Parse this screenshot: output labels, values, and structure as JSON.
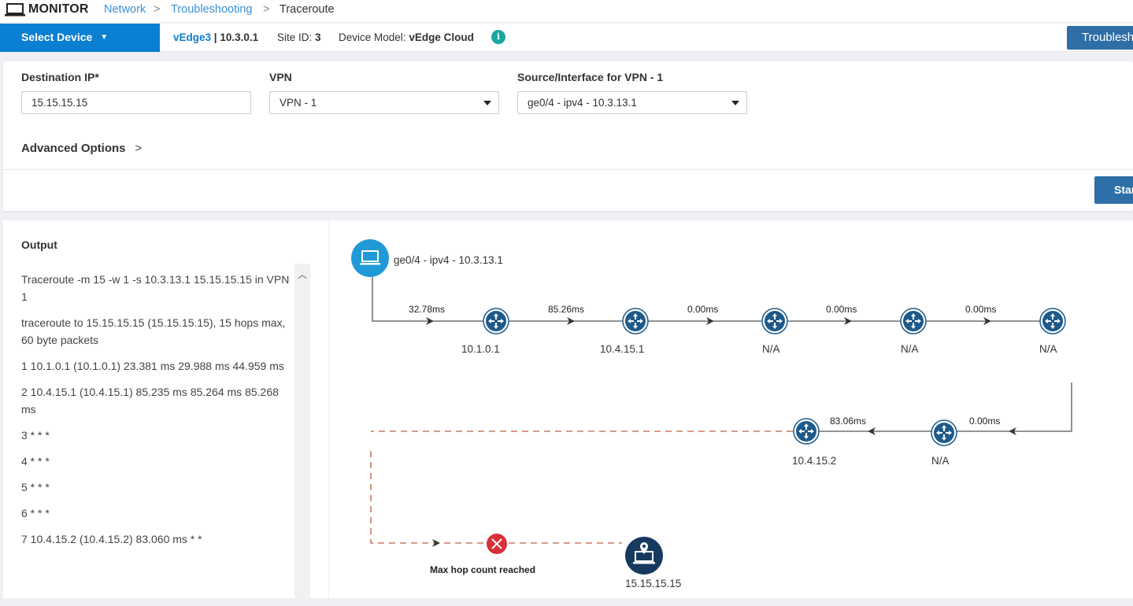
{
  "header": {
    "title": "MONITOR",
    "breadcrumb": [
      "Network",
      "Troubleshooting",
      "Traceroute"
    ],
    "separator": ">"
  },
  "device_bar": {
    "select_label": "Select Device",
    "device_name": "vEdge3",
    "device_ip": "| 10.3.0.1",
    "site_label": "Site ID:",
    "site_value": "3",
    "model_label": "Device Model:",
    "model_value": "vEdge Cloud",
    "info_glyph": "i",
    "troubleshoot_button": "Troubleshooting"
  },
  "form": {
    "destination_label": "Destination IP*",
    "destination_value": "15.15.15.15",
    "vpn_label": "VPN",
    "vpn_value": "VPN - 1",
    "source_label": "Source/Interface for VPN - 1",
    "source_value": "ge0/4 - ipv4 - 10.3.13.1",
    "advanced_label": "Advanced Options",
    "advanced_chevron": ">",
    "start_button": "Start"
  },
  "output": {
    "title": "Output",
    "lines": [
      "Traceroute -m 15 -w 1 -s 10.3.13.1 15.15.15.15 in VPN 1",
      "traceroute to 15.15.15.15 (15.15.15.15), 15 hops max, 60 byte packets",
      "1 10.1.0.1 (10.1.0.1) 23.381 ms 29.988 ms 44.959 ms",
      "2 10.4.15.1 (10.4.15.1) 85.235 ms 85.264 ms 85.268 ms",
      "3 * * *",
      "4 * * *",
      "5 * * *",
      "6 * * *",
      "7 10.4.15.2 (10.4.15.2) 83.060 ms * *"
    ]
  },
  "graph": {
    "source_label": "ge0/4 - ipv4 - 10.3.13.1",
    "row1": {
      "hops": [
        "10.1.0.1",
        "10.4.15.1",
        "N/A",
        "N/A",
        "N/A"
      ],
      "latencies": [
        "32.78ms",
        "85.26ms",
        "0.00ms",
        "0.00ms",
        "0.00ms"
      ]
    },
    "row2": {
      "hops": [
        "N/A",
        "10.4.15.2"
      ],
      "latencies": [
        "0.00ms",
        "83.06ms"
      ]
    },
    "error_label": "Max hop count reached",
    "destination_label": "15.15.15.15",
    "colors": {
      "router": "#1e5a8a",
      "source": "#1f9ad6",
      "destination": "#163a5f",
      "error": "#d9303a",
      "dashed": "#c97a63",
      "line": "#555555"
    },
    "icons": [
      "laptop-icon",
      "router-icon",
      "error-icon",
      "destination-icon"
    ]
  }
}
